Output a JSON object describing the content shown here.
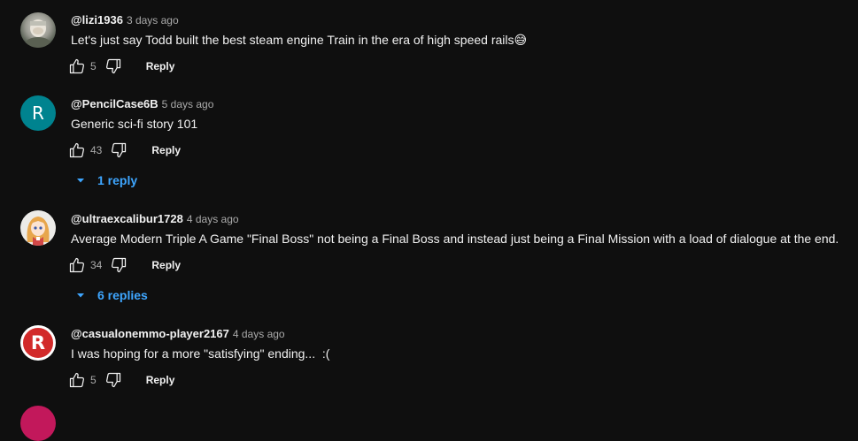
{
  "comments": [
    {
      "author": "@lizi1936",
      "timestamp": "3 days ago",
      "text": "Let's just say Todd built the best steam engine Train in the era of high speed rails😅",
      "likes": "5",
      "reply_label": "Reply",
      "avatar": {
        "type": "photo",
        "icon": "user-photo-icon"
      }
    },
    {
      "author": "@PencilCase6B",
      "timestamp": "5 days ago",
      "text": "Generic sci-fi story 101",
      "likes": "43",
      "reply_label": "Reply",
      "avatar": {
        "type": "letter",
        "letter": "R",
        "color": "#00838f"
      },
      "replies_label": "1 reply"
    },
    {
      "author": "@ultraexcalibur1728",
      "timestamp": "4 days ago",
      "text": "Average Modern Triple A Game \"Final Boss\" not being a Final Boss and instead just being a Final Mission with a load of dialogue at the end.",
      "likes": "34",
      "reply_label": "Reply",
      "avatar": {
        "type": "anime",
        "icon": "anime-girl-icon"
      },
      "replies_label": "6 replies"
    },
    {
      "author": "@casualonemmo-player2167",
      "timestamp": "4 days ago",
      "text": "I was hoping for a more \"satisfying\" ending...  :(",
      "likes": "5",
      "reply_label": "Reply",
      "avatar": {
        "type": "letter",
        "letter": "R",
        "color": "#d22a2a"
      }
    }
  ],
  "colors": {
    "background": "#0f0f0f",
    "link": "#3ea6ff",
    "text": "#f1f1f1",
    "muted": "#aaaaaa"
  }
}
